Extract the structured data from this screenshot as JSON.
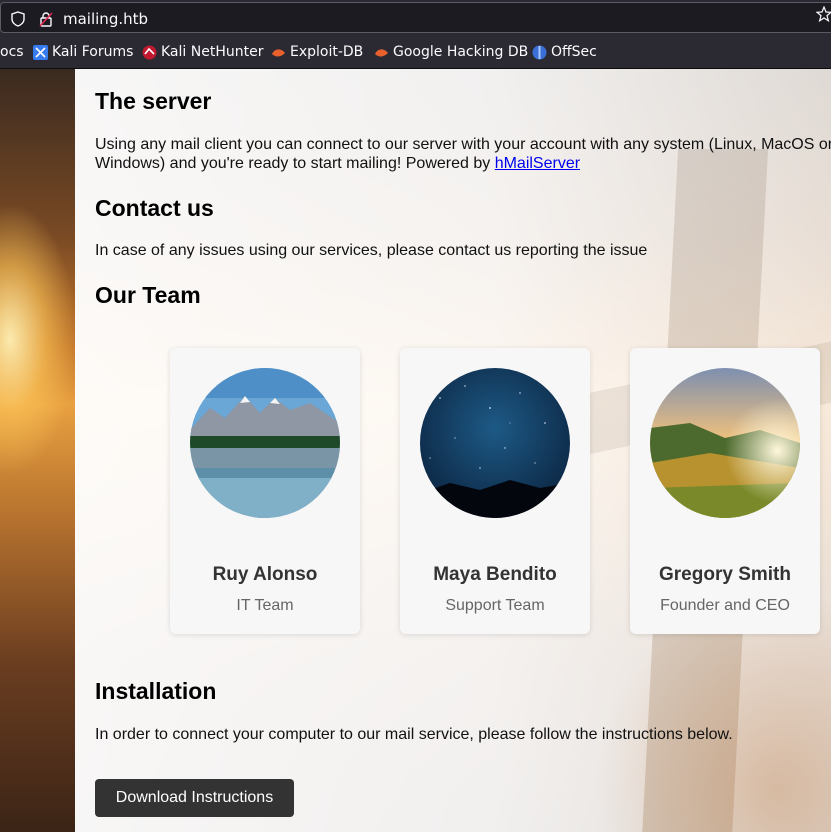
{
  "browser": {
    "url": "mailing.htb",
    "bookmarks": [
      {
        "label": "ocs",
        "icon": "docs-icon"
      },
      {
        "label": "Kali Forums",
        "icon": "kali-forums-icon"
      },
      {
        "label": "Kali NetHunter",
        "icon": "kali-nethunter-icon"
      },
      {
        "label": "Exploit-DB",
        "icon": "exploit-db-icon"
      },
      {
        "label": "Google Hacking DB",
        "icon": "google-hacking-db-icon"
      },
      {
        "label": "OffSec",
        "icon": "offsec-icon"
      }
    ]
  },
  "sections": {
    "server": {
      "heading": "The server",
      "text_line1": "Using any mail client you can connect to our server with your account with any system (Linux, MacOS or",
      "text_line2": "Windows) and you're ready to start mailing! Powered by ",
      "link": "hMailServer"
    },
    "contact": {
      "heading": "Contact us",
      "text": "In case of any issues using our services, please contact us reporting the issue"
    },
    "team": {
      "heading": "Our Team",
      "members": [
        {
          "name": "Ruy Alonso",
          "role": "IT Team",
          "photo": "mountain-lake-photo"
        },
        {
          "name": "Maya Bendito",
          "role": "Support Team",
          "photo": "night-sky-photo"
        },
        {
          "name": "Gregory Smith",
          "role": "Founder and CEO",
          "photo": "sunset-meadow-photo"
        }
      ]
    },
    "installation": {
      "heading": "Installation",
      "text": "In order to connect your computer to our mail service, please follow the instructions below.",
      "button": "Download Instructions"
    }
  },
  "colors": {
    "chrome_bg": "#2b2a33",
    "button_bg": "#333333",
    "link": "#0000ee"
  }
}
